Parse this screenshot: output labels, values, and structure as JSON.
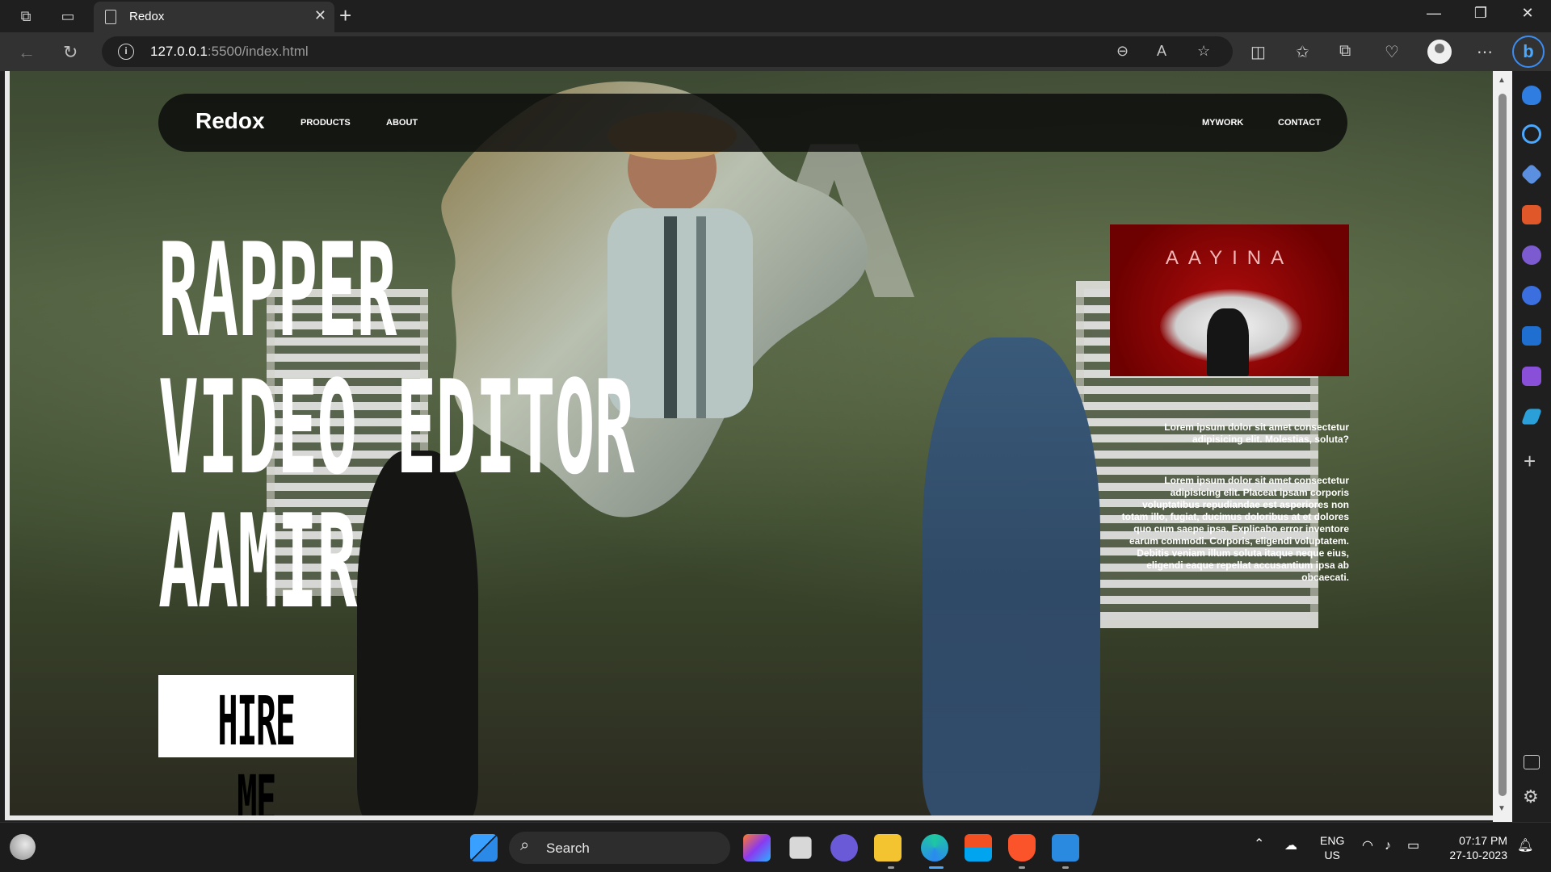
{
  "browser": {
    "tab_title": "Redox",
    "url_host": "127.0.0.1",
    "url_rest": ":5500/index.html",
    "tab_close_glyph": "✕",
    "new_tab_glyph": "+",
    "icons": [
      "workspaces-icon",
      "tab-actions-icon",
      "back-icon",
      "refresh-icon",
      "zoom-icon",
      "read-aloud-icon",
      "favorite-icon",
      "split-screen-icon",
      "favorites-icon",
      "collections-icon",
      "performance-icon",
      "profile-icon",
      "more-icon",
      "copilot-icon"
    ]
  },
  "site": {
    "brand": "Redox",
    "nav": {
      "products": "PRODUCTS",
      "about": "ABOUT",
      "mywork": "MYWORK",
      "contact": "CONTACT"
    },
    "hero": {
      "line1": "RAPPER",
      "line2": "VIDEO EDITOR",
      "line3": "AAMIR"
    },
    "cta": "HIRE ME",
    "album_title": "AAYINA",
    "para1": "Lorem ipsum dolor sit amet consectetur adipisicing elit. Molestias, soluta?",
    "para2": "Lorem ipsum dolor sit amet consectetur adipisicing elit. Placeat ipsam corporis voluptatibus repudiandae est asperiores non totam illo, fugiat, ducimus doloribus at et dolores quo cum saepe ipsa. Explicabo error inventore earum commodi. Corporis, eligendi voluptatem. Debitis veniam illum soluta itaque neque eius, eligendi eaque repellat accusantium ipsa ab obcaecati."
  },
  "taskbar": {
    "search_placeholder": "Search",
    "lang": "ENG",
    "region": "US",
    "time": "07:17 PM",
    "date": "27-10-2023"
  },
  "colors": {
    "accent": "#3b8df3",
    "album_red": "#b10d0d",
    "navbar_bg": "#0a0a0a"
  }
}
